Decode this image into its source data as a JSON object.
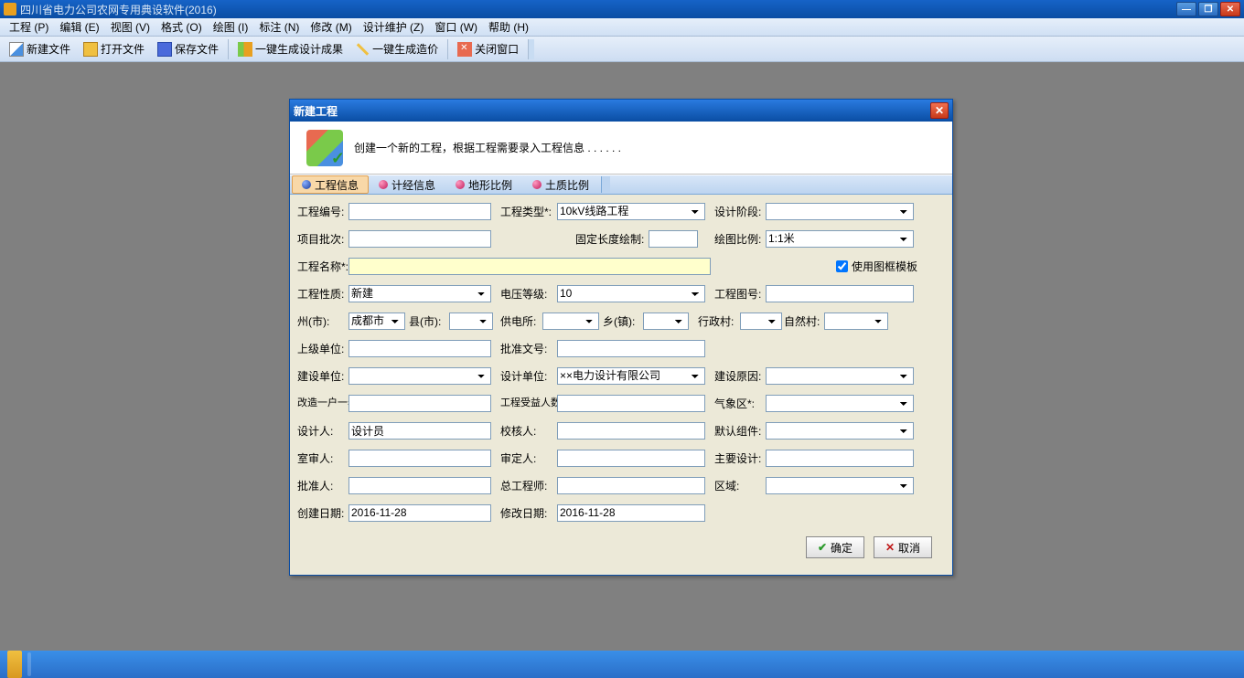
{
  "app": {
    "title": "四川省电力公司农网专用典设软件(2016)"
  },
  "menu": {
    "items": [
      "工程 (P)",
      "编辑 (E)",
      "视图 (V)",
      "格式 (O)",
      "绘图 (I)",
      "标注 (N)",
      "修改 (M)",
      "设计维护 (Z)",
      "窗口 (W)",
      "帮助 (H)"
    ]
  },
  "toolbar": {
    "new": "新建文件",
    "open": "打开文件",
    "save": "保存文件",
    "gen_design": "一键生成设计成果",
    "gen_cost": "一键生成造价",
    "close_win": "关闭窗口"
  },
  "dialog": {
    "title": "新建工程",
    "desc": "创建一个新的工程，根据工程需要录入工程信息 . . . . . .",
    "tabs": [
      "工程信息",
      "计经信息",
      "地形比例",
      "土质比例"
    ],
    "labels": {
      "proj_no": "工程编号:",
      "proj_type": "工程类型*:",
      "design_stage": "设计阶段:",
      "batch": "项目批次:",
      "fixed_len": "固定长度绘制:",
      "draw_scale": "绘图比例:",
      "proj_name": "工程名称*:",
      "use_template": "使用图框模板",
      "proj_nature": "工程性质:",
      "volt_level": "电压等级:",
      "proj_drawing_no": "工程图号:",
      "prefecture": "州(市):",
      "county": "县(市):",
      "power_station": "供电所:",
      "town": "乡(镇):",
      "admin_village": "行政村:",
      "natural_village": "自然村:",
      "superior_unit": "上级单位:",
      "approval_no": "批准文号:",
      "build_unit": "建设单位:",
      "design_unit": "设计单位:",
      "build_reason": "建设原因:",
      "meter_count": "改造一户一表户数",
      "beneficiary": "工程受益人数:",
      "weather_zone": "气象区*:",
      "designer": "设计人:",
      "checker": "校核人:",
      "default_comp": "默认组件:",
      "office_reviewer": "室审人:",
      "approver_p": "审定人:",
      "main_design": "主要设计:",
      "approver": "批准人:",
      "chief_eng": "总工程师:",
      "region": "区域:",
      "create_date": "创建日期:",
      "modify_date": "修改日期:"
    },
    "values": {
      "proj_type": "10kV线路工程",
      "draw_scale": "1:1米",
      "proj_nature": "新建",
      "volt_level": "10",
      "prefecture": "成都市",
      "design_unit": "××电力设计有限公司",
      "designer": "设计员",
      "create_date": "2016-11-28",
      "modify_date": "2016-11-28"
    },
    "buttons": {
      "ok": "确定",
      "cancel": "取消"
    }
  }
}
